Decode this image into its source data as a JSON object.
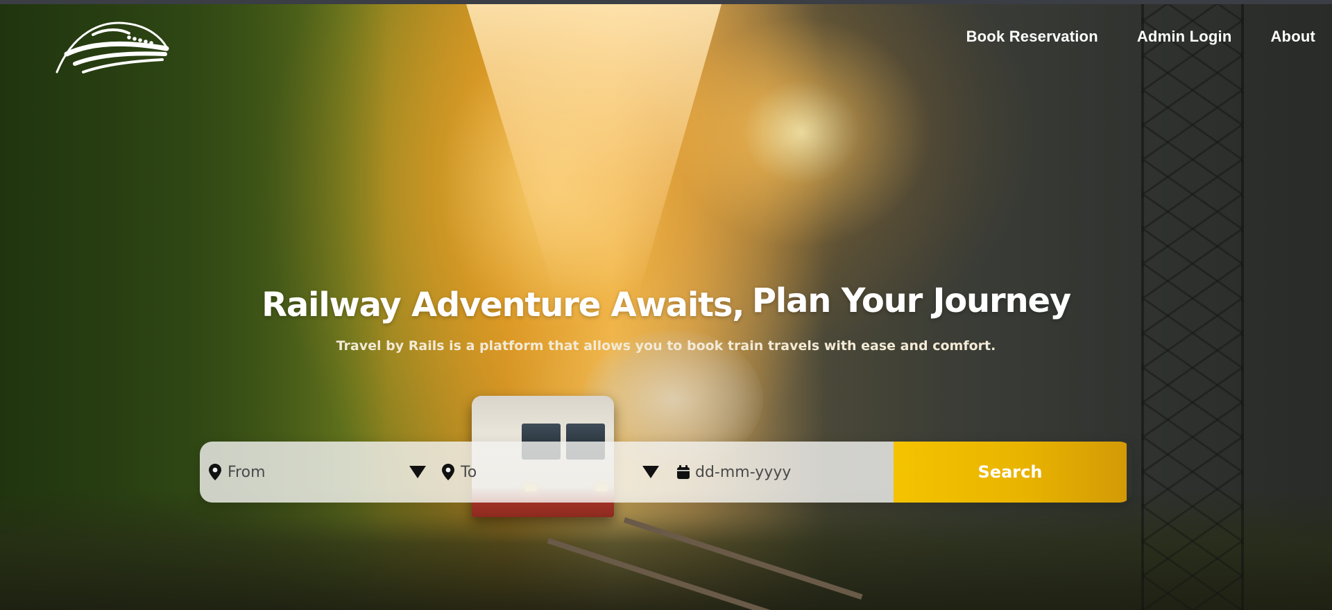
{
  "nav": {
    "logo_name": "train-logo",
    "links": [
      {
        "label": "Book Reservation"
      },
      {
        "label": "Admin Login"
      },
      {
        "label": "About"
      }
    ]
  },
  "hero": {
    "headline_part1": "Railway Adventure Awaits,",
    "headline_part2": "Plan Your Journey",
    "subheadline": "Travel by Rails is a platform that allows you to book train travels with ease and comfort."
  },
  "search": {
    "from_placeholder": "From",
    "to_placeholder": "To",
    "date_placeholder": "dd-mm-yyyy",
    "button_label": "Search"
  },
  "colors": {
    "accent": "#F4C300",
    "nav_text": "#FFFFFF",
    "search_field_bg": "#F0F0EE"
  }
}
